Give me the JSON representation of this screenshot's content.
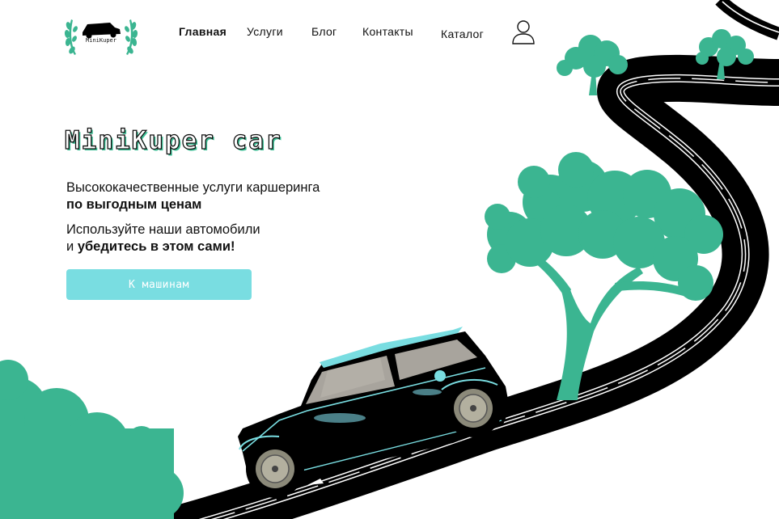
{
  "logo": {
    "text": "MiniKuper",
    "icon": "car-laurel-logo"
  },
  "nav": {
    "items": [
      {
        "label": "Главная",
        "active": true
      },
      {
        "label": "Услуги",
        "active": false
      },
      {
        "label": "Блог",
        "active": false
      },
      {
        "label": "Контакты",
        "active": false
      },
      {
        "label": "Каталог",
        "active": false
      }
    ],
    "user_icon": "user-icon"
  },
  "hero": {
    "title": "MiniKuper car",
    "lead1_line1": "Высококачественные услуги каршеринга",
    "lead1_line2": "по  выгодным ценам",
    "lead2_line1": "Используйте наши автомобили",
    "lead2_line2_prefix": "и ",
    "lead2_line2_bold": "убедитесь в этом сами!",
    "cta_label": "К машинам"
  },
  "colors": {
    "accent_green": "#3bb591",
    "button": "#79dde1",
    "road": "#000000",
    "car_body": "#000000",
    "car_roof": "#79dde1",
    "window": "#a8a49d"
  }
}
